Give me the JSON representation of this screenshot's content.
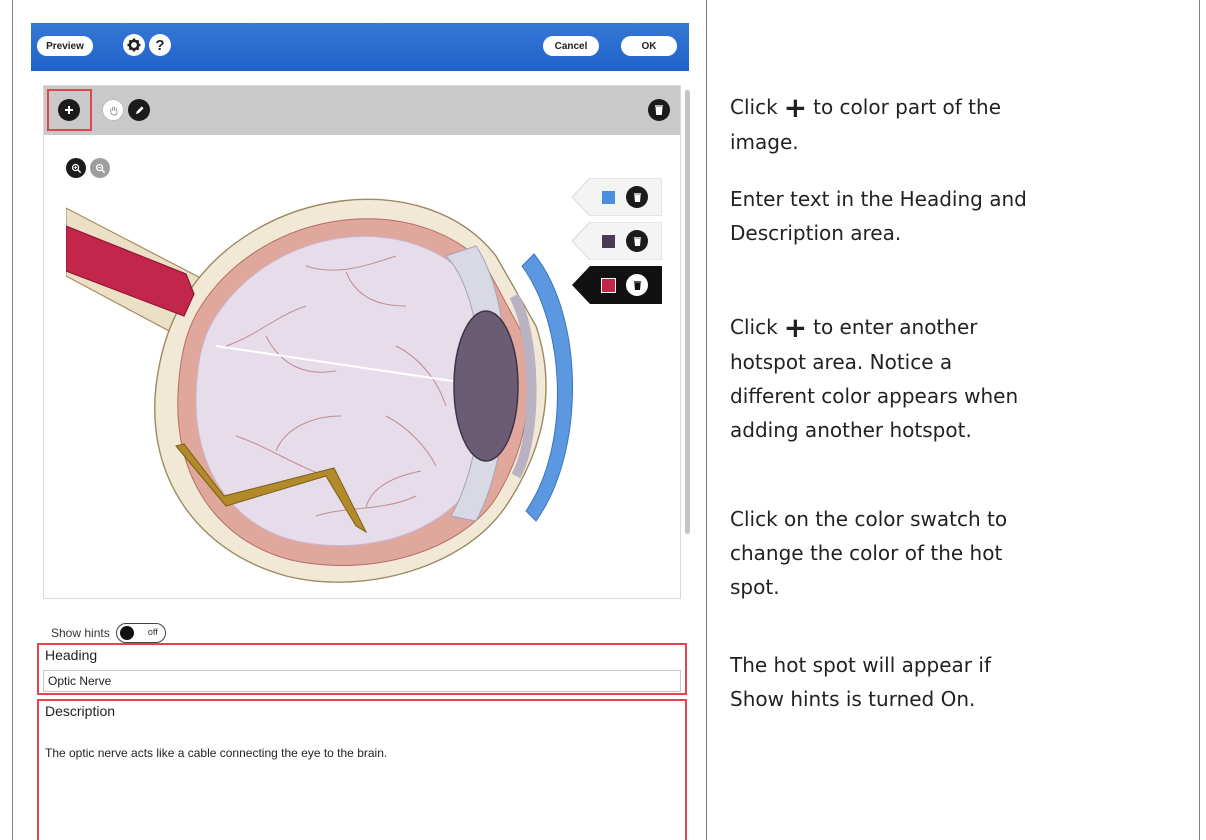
{
  "editor": {
    "header": {
      "preview_label": "Preview",
      "settings_icon": "gear-icon",
      "help_label": "?",
      "cancel_label": "Cancel",
      "ok_label": "OK",
      "accent_color": "#2a6fd2"
    },
    "toolbar": {
      "tools": [
        "add-hotspot-icon",
        "hand-icon",
        "pencil-icon"
      ],
      "delete_icon": "trash-icon"
    },
    "zoom": [
      "zoom-in-icon",
      "zoom-out-icon"
    ],
    "hotspots": [
      {
        "color": "#4a8fe0",
        "selected": false
      },
      {
        "color": "#4a3a55",
        "selected": false
      },
      {
        "color": "#c2264a",
        "selected": true
      }
    ],
    "show_hints": {
      "label": "Show hints",
      "state": "off"
    },
    "heading": {
      "label": "Heading",
      "value": "Optic Nerve"
    },
    "description": {
      "label": "Description",
      "value": "The optic nerve acts like a cable connecting the eye to the brain."
    }
  },
  "instructions": {
    "p1_before": "Click",
    "p1_after": "to color part of the",
    "p1_line2": "image.",
    "p2_line1": "Enter text in the Heading and",
    "p2_line2": "Description area.",
    "p3_before": "Click",
    "p3_after": "to enter another",
    "p3_line2": "hotspot area. Notice a",
    "p3_line3": "different color appears when",
    "p3_line4": "adding another hotspot.",
    "p4_line1": "Click on the color swatch to",
    "p4_line2": "change the color of the hot",
    "p4_line3": "spot.",
    "p5_line1": "The hot spot will appear if",
    "p5_line2": "Show hints is turned On.",
    "plus_symbol": "+"
  }
}
